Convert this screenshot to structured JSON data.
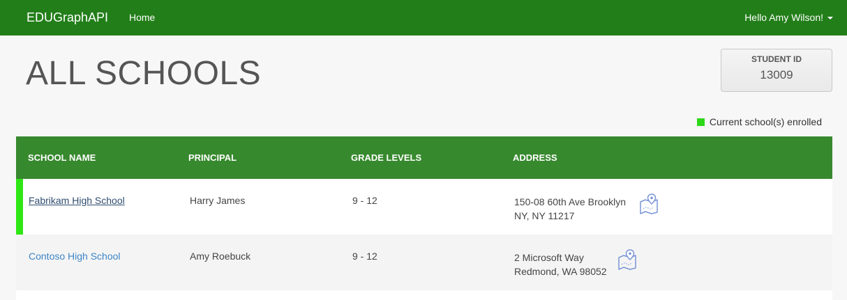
{
  "navbar": {
    "brand": "EDUGraphAPI",
    "home": "Home",
    "user_greeting": "Hello Amy Wilson!"
  },
  "page": {
    "title": "ALL SCHOOLS"
  },
  "student": {
    "label": "STUDENT ID",
    "id": "13009"
  },
  "legend": {
    "label": "Current school(s) enrolled",
    "color": "#2cd817"
  },
  "table": {
    "headers": [
      "SCHOOL NAME",
      "PRINCIPAL",
      "GRADE LEVELS",
      "ADDRESS"
    ],
    "rows": [
      {
        "name": "Fabrikam High School",
        "principal": "Harry James",
        "grades": "9 - 12",
        "address_line1": "150-08 60th Ave Brooklyn",
        "address_line2": "NY, NY 11217",
        "current": true
      },
      {
        "name": "Contoso High School",
        "principal": "Amy Roebuck",
        "grades": "9 - 12",
        "address_line1": "2 Microsoft Way",
        "address_line2": "Redmond, WA 98052",
        "current": false
      }
    ]
  },
  "colors": {
    "navbar": "#227e19",
    "table_header": "#37892e",
    "enrolled_accent": "#2ee613",
    "link": "#3d85c6"
  },
  "icons": {
    "map": "map-pin-icon"
  }
}
